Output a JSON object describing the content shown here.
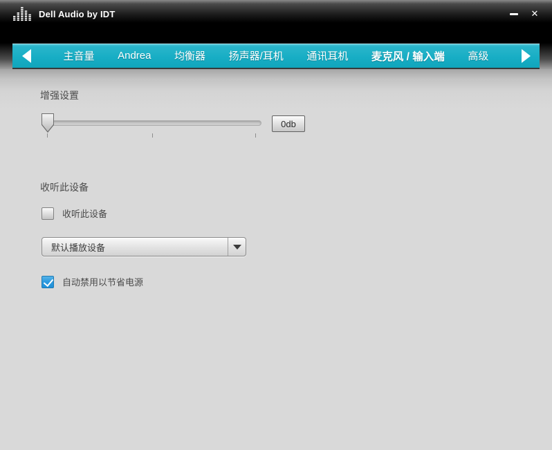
{
  "titlebar": {
    "title": "Dell Audio by IDT",
    "app_icon": "equalizer-bars-icon",
    "minimize_icon": "minimize-dash",
    "close_glyph": "✕"
  },
  "tabbar": {
    "prev_icon": "left-triangle",
    "next_icon": "right-triangle",
    "tabs": [
      {
        "label": "主音量",
        "selected": false
      },
      {
        "label": "Andrea",
        "selected": false
      },
      {
        "label": "均衡器",
        "selected": false
      },
      {
        "label": "扬声器/耳机",
        "selected": false
      },
      {
        "label": "通讯耳机",
        "selected": false
      },
      {
        "label": "麦克风 / 输入端",
        "selected": true
      },
      {
        "label": "高级",
        "selected": false
      }
    ]
  },
  "boost": {
    "section_label": "增强设置",
    "slider": {
      "value_label": "0db",
      "percent": 0,
      "tick_percents": [
        2,
        50,
        97
      ]
    }
  },
  "listen": {
    "section_label": "收听此设备",
    "listen_checkbox": {
      "label": "收听此设备",
      "checked": false
    },
    "playback_device_dropdown": {
      "value": "默认播放设备",
      "arrow_icon": "down-triangle"
    },
    "power_save_checkbox": {
      "label": "自动禁用以节省电源",
      "checked": true
    }
  },
  "colors": {
    "accent_teal": "#18aec5",
    "checked_blue": "#2e9be0",
    "titlebar_bg": "#000000",
    "content_bg": "#d9d9d9"
  }
}
